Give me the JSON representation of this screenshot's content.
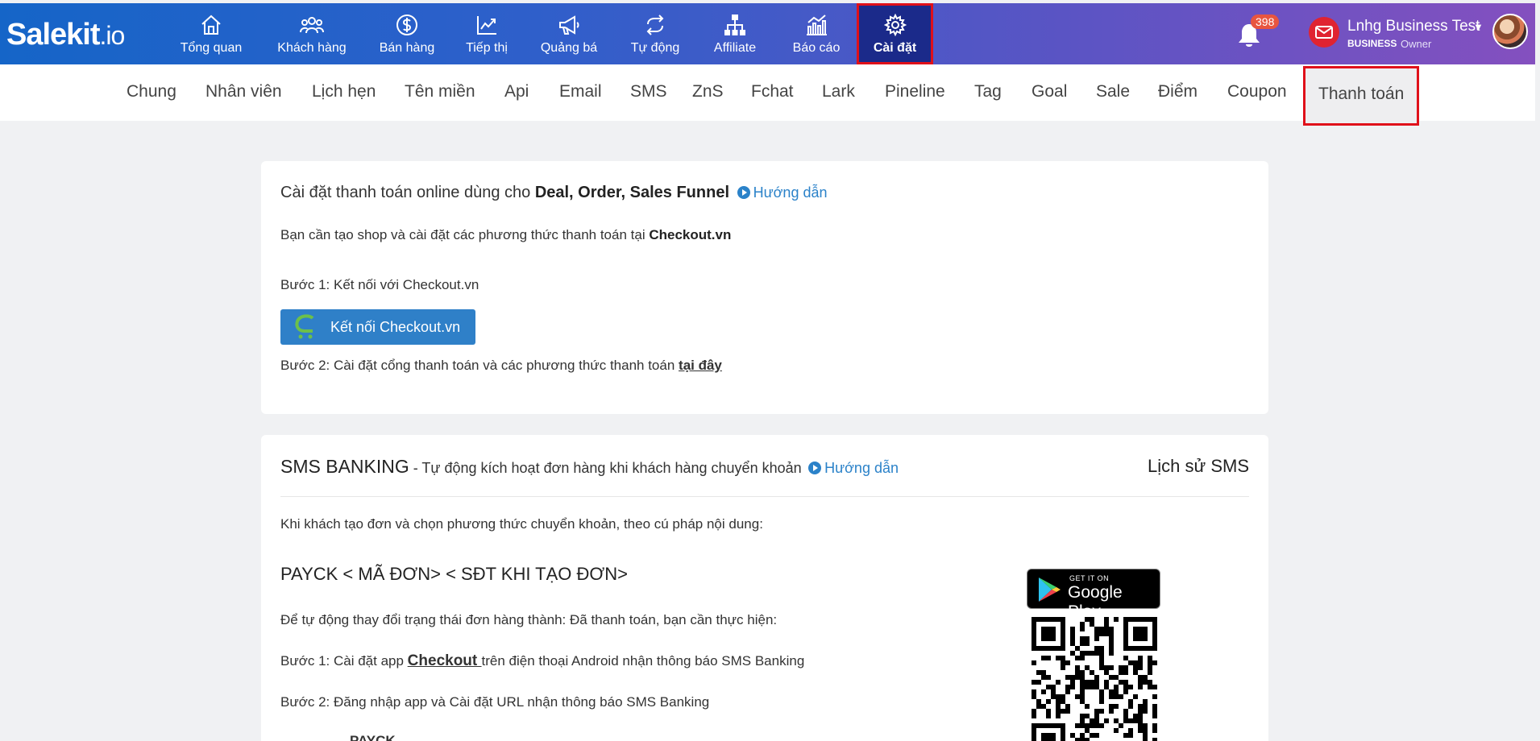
{
  "brand": {
    "name": "Salekit",
    "suffix": ".io"
  },
  "nav": {
    "items": [
      {
        "label": "Tổng quan",
        "icon": "home-icon"
      },
      {
        "label": "Khách hàng",
        "icon": "users-icon"
      },
      {
        "label": "Bán hàng",
        "icon": "dollar-icon"
      },
      {
        "label": "Tiếp thị",
        "icon": "chart-line-icon"
      },
      {
        "label": "Quảng bá",
        "icon": "megaphone-icon"
      },
      {
        "label": "Tự động",
        "icon": "repeat-icon"
      },
      {
        "label": "Affiliate",
        "icon": "sitemap-icon"
      },
      {
        "label": "Báo cáo",
        "icon": "report-icon"
      },
      {
        "label": "Cài đặt",
        "icon": "gear-icon",
        "active": true
      }
    ]
  },
  "notifications": {
    "count": "398"
  },
  "account": {
    "name": "Lnhg Business Test",
    "plan": "BUSINESS",
    "role": "Owner"
  },
  "subtabs": [
    "Chung",
    "Nhân viên",
    "Lịch hẹn",
    "Tên miền",
    "Api",
    "Email",
    "SMS",
    "ZnS",
    "Fchat",
    "Lark",
    "Pineline",
    "Tag",
    "Goal",
    "Sale",
    "Điểm",
    "Coupon",
    "Thanh toán"
  ],
  "active_subtab": "Thanh toán",
  "payment": {
    "title_prefix": "Cài đặt thanh toán online dùng cho ",
    "title_bold": "Deal, Order, Sales Funnel",
    "guide_link": "Hướng dẫn",
    "intro_prefix": "Bạn cần tạo shop và cài đặt các phương thức thanh toán tại ",
    "intro_bold": "Checkout.vn",
    "step1": "Bước 1: Kết nối với Checkout.vn",
    "connect_button": "Kết nối Checkout.vn",
    "step2_prefix": "Bước 2: Cài đặt cổng thanh toán và các phương thức thanh toán ",
    "step2_link": "tại đây"
  },
  "sms_banking": {
    "title": "SMS BANKING",
    "subtitle": " - Tự động kích hoạt đơn hàng khi khách hàng chuyển khoản",
    "guide_link": "Hướng dẫn",
    "history_link": "Lịch sử SMS",
    "desc": "Khi khách tạo đơn và chọn phương thức chuyển khoản, theo cú pháp nội dung:",
    "syntax": "PAYCK < MÃ ĐƠN> < SĐT KHI TẠO ĐƠN>",
    "auto_text": "Để tự động thay đổi trạng thái đơn hàng thành: Đã thanh toán, bạn cần thực hiện:",
    "step1_prefix": "Bước 1: Cài đặt app ",
    "step1_link": "Checkout ",
    "step1_suffix": "trên điện thoại Android nhận thông báo SMS Banking",
    "step2": "Bước 2: Đăng nhập app và Cài đặt URL nhận thông báo SMS Banking",
    "step3_partial": "PAYCK",
    "gplay_small": "GET IT ON",
    "gplay_big": "Google Play"
  },
  "colors": {
    "topbar_start": "#1565c8",
    "topbar_end": "#8450bf",
    "active_nav": "#1b2a8a",
    "highlight": "#e0101a",
    "link": "#2b82c9",
    "button": "#2f80c8"
  }
}
